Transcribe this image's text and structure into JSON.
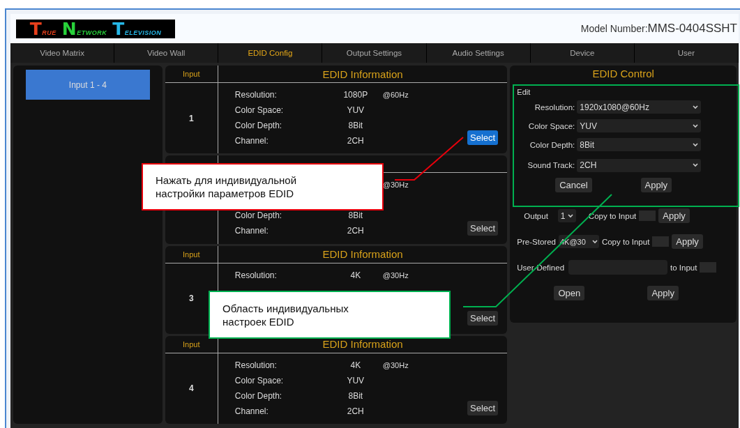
{
  "header": {
    "logo": [
      {
        "initial": "T",
        "rest": "RUE"
      },
      {
        "initial": "N",
        "rest": "ETWORK"
      },
      {
        "initial": "T",
        "rest": "ELEVISION"
      }
    ],
    "model_label": "Model Number:",
    "model_value": "MMS-0404SSHT"
  },
  "tabs": [
    {
      "label": "Video Matrix",
      "selected": false
    },
    {
      "label": "Video Wall",
      "selected": false
    },
    {
      "label": "EDID Config",
      "selected": true
    },
    {
      "label": "Output Settings",
      "selected": false
    },
    {
      "label": "Audio Settings",
      "selected": false
    },
    {
      "label": "Device",
      "selected": false
    },
    {
      "label": "User",
      "selected": false
    }
  ],
  "sidebar": {
    "items": [
      {
        "label": "Input 1 - 4",
        "selected": true
      }
    ]
  },
  "inputs": [
    {
      "input_label": "Input",
      "header": "EDID Information",
      "number": "1",
      "rows": [
        {
          "label": "Resolution:",
          "value": "1080P",
          "rate": "@60Hz"
        },
        {
          "label": "Color Space:",
          "value": "YUV"
        },
        {
          "label": "Color Depth:",
          "value": "8Bit"
        },
        {
          "label": "Channel:",
          "value": "2CH"
        }
      ],
      "select": {
        "label": "Select",
        "active": true
      }
    },
    {
      "rows": [
        {
          "rate": "@30Hz"
        },
        {},
        {
          "label": "Color Depth:",
          "value": "8Bit"
        },
        {
          "label": "Channel:",
          "value": "2CH"
        }
      ],
      "select": {
        "label": "Select",
        "active": false
      }
    },
    {
      "input_label": "Input",
      "header": "EDID Information",
      "number": "3",
      "rows": [
        {
          "label": "Resolution:",
          "value": "4K",
          "rate": "@30Hz"
        },
        {},
        {},
        {}
      ],
      "select": {
        "label": "Select",
        "active": false
      }
    },
    {
      "input_label": "Input",
      "header": "EDID Information",
      "number": "4",
      "rows": [
        {
          "label": "Resolution:",
          "value": "4K",
          "rate": "@30Hz"
        },
        {
          "label": "Color Space:",
          "value": "YUV"
        },
        {
          "label": "Color Depth:",
          "value": "8Bit"
        },
        {
          "label": "Channel:",
          "value": "2CH"
        }
      ],
      "select": {
        "label": "Select",
        "active": false
      }
    }
  ],
  "edid_control": {
    "title": "EDID Control",
    "edit_label": "Edit",
    "fields": [
      {
        "label": "Resolution:",
        "value": "1920x1080@60Hz"
      },
      {
        "label": "Color Space:",
        "value": "YUV"
      },
      {
        "label": "Color Depth:",
        "value": "8Bit"
      },
      {
        "label": "Sound Track:",
        "value": "2CH"
      }
    ],
    "cancel": "Cancel",
    "apply": "Apply",
    "output": {
      "label": "Output",
      "value": "1",
      "copy_label": "Copy to Input",
      "apply": "Apply"
    },
    "pre_stored": {
      "label": "Pre-Stored",
      "value": "4K@30",
      "copy_label": "Copy to Input",
      "apply": "Apply"
    },
    "user_defined": {
      "label": "User-Defined",
      "to_label": "to Input",
      "open": "Open",
      "apply": "Apply"
    }
  },
  "annotations": [
    {
      "text": "Нажать для индивидуальной настройки параметров EDID",
      "color": "#e8000b"
    },
    {
      "text": "Область индивидуальных настроек EDID",
      "color": "#00b050"
    }
  ]
}
